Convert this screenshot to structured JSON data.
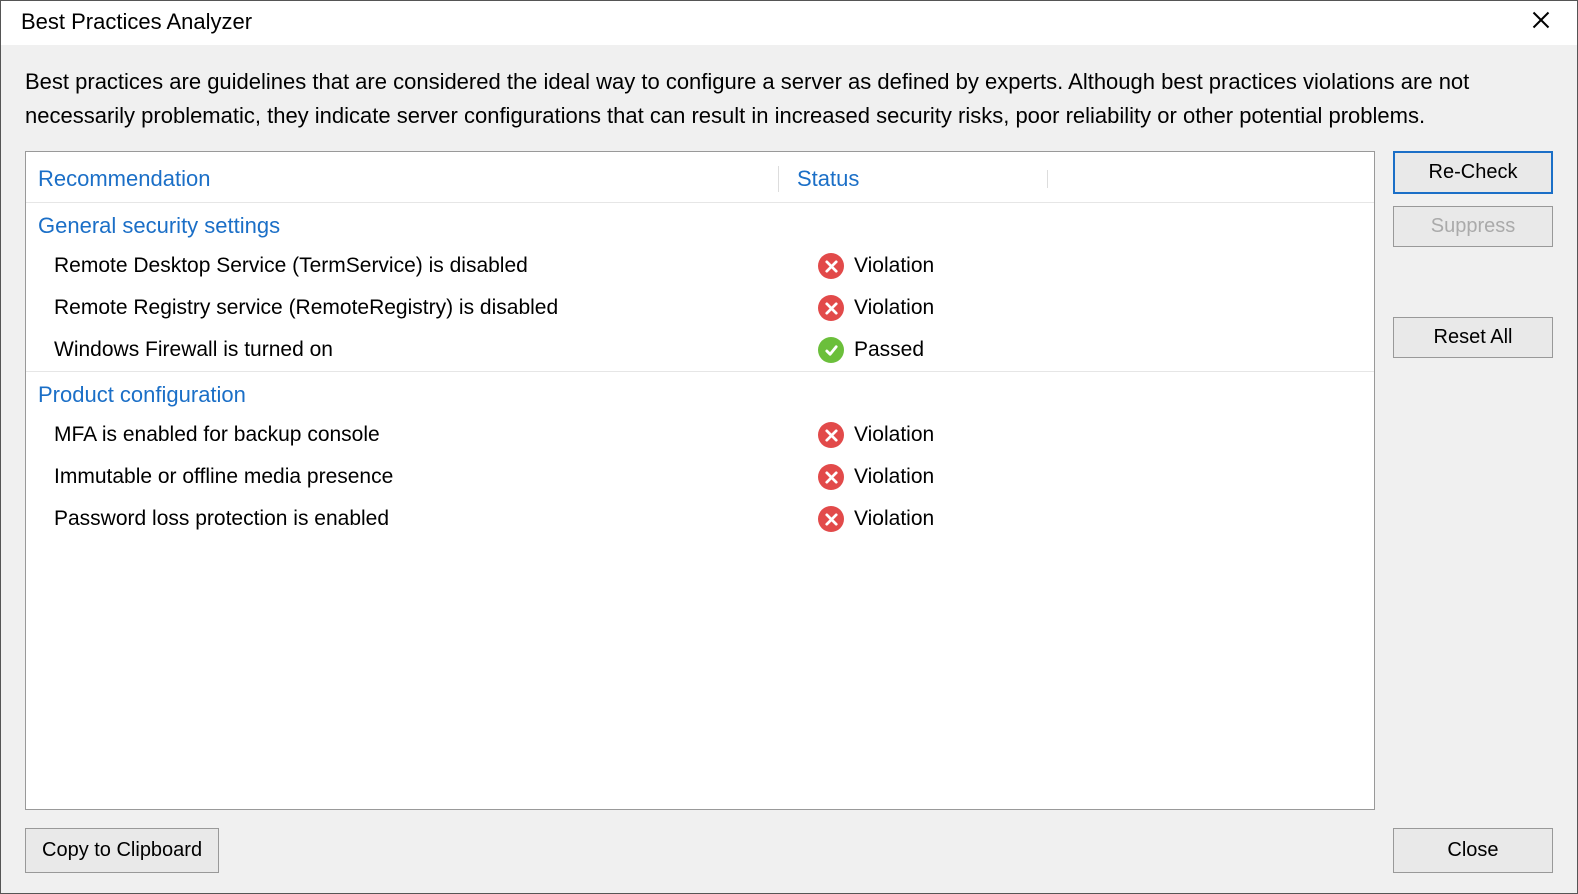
{
  "title": "Best Practices Analyzer",
  "description": "Best practices are guidelines that are considered the ideal way to configure a server as defined by experts. Although best practices violations are not necessarily problematic, they indicate server configurations that can result in increased security risks, poor reliability or other potential problems.",
  "columns": {
    "recommendation": "Recommendation",
    "status": "Status"
  },
  "groups": [
    {
      "title": "General security settings",
      "items": [
        {
          "label": "Remote Desktop Service (TermService) is disabled",
          "status": "Violation"
        },
        {
          "label": "Remote Registry service (RemoteRegistry) is disabled",
          "status": "Violation"
        },
        {
          "label": "Windows Firewall is turned on",
          "status": "Passed"
        }
      ]
    },
    {
      "title": "Product configuration",
      "items": [
        {
          "label": "MFA is enabled for backup console",
          "status": "Violation"
        },
        {
          "label": "Immutable or offline media presence",
          "status": "Violation"
        },
        {
          "label": "Password loss protection is enabled",
          "status": "Violation"
        }
      ]
    }
  ],
  "buttons": {
    "recheck": "Re-Check",
    "suppress": "Suppress",
    "resetall": "Reset All",
    "copy": "Copy to Clipboard",
    "close": "Close"
  }
}
